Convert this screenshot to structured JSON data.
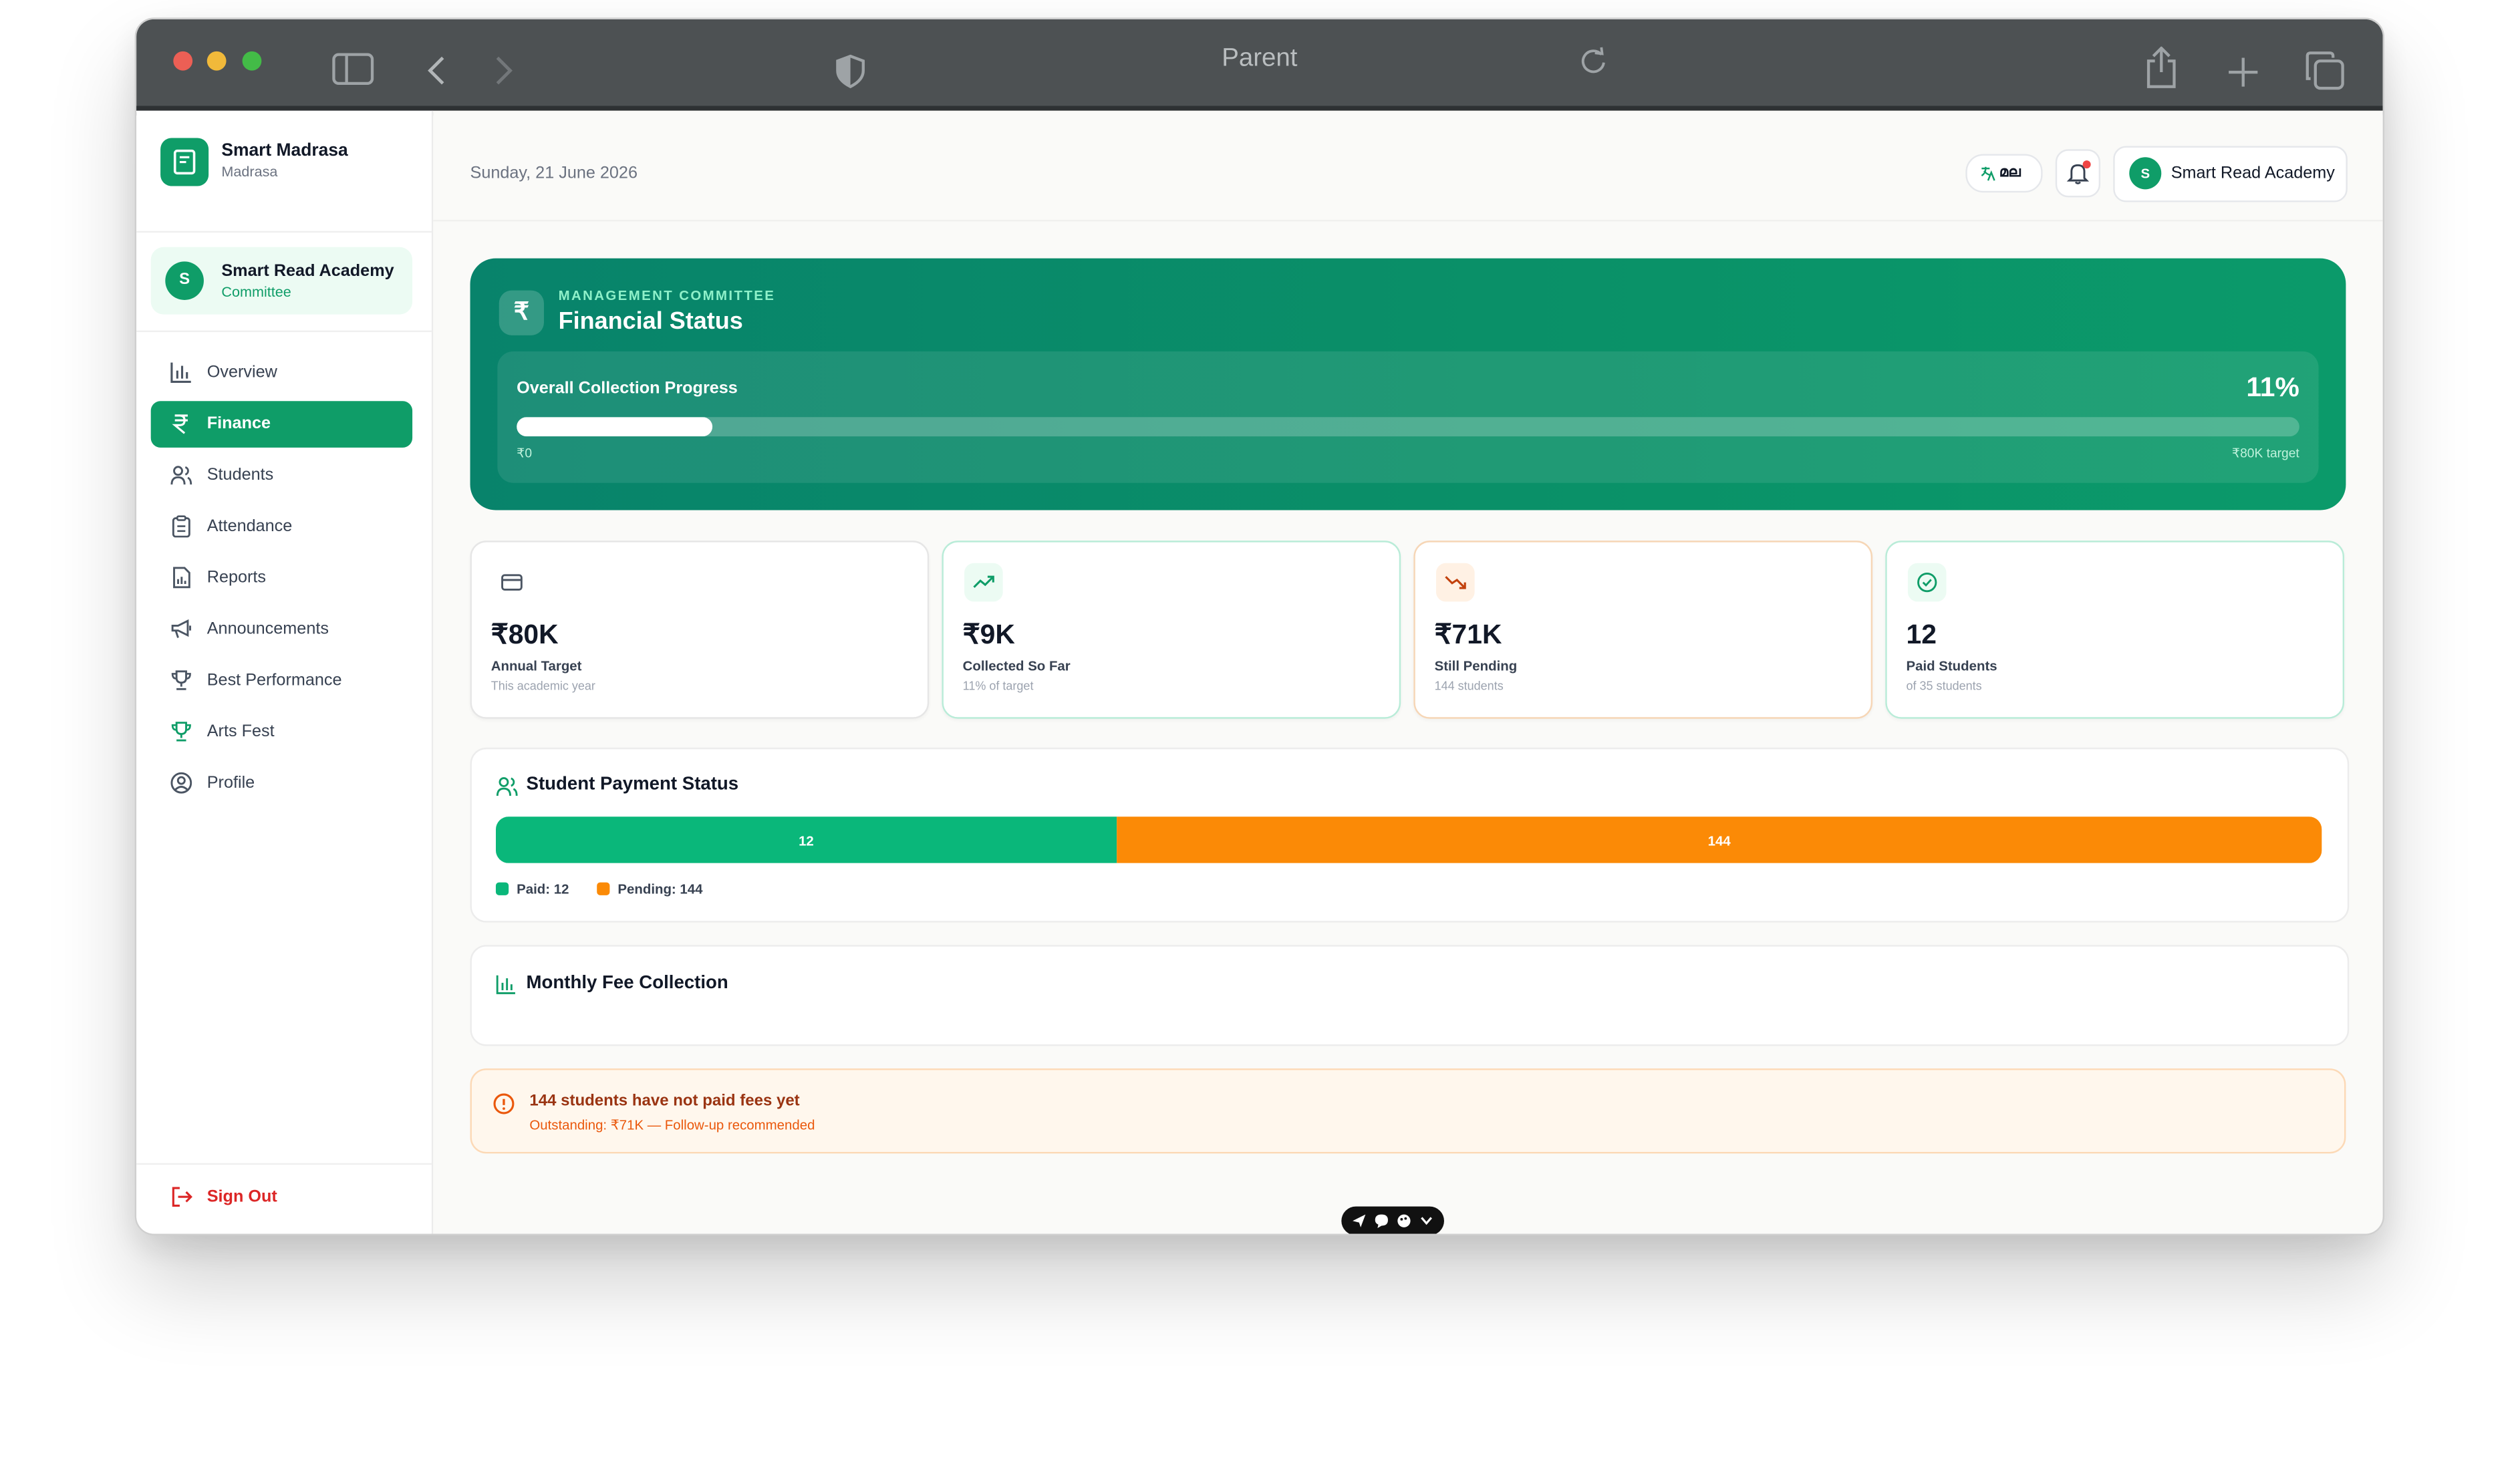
{
  "browser": {
    "title": "Parent"
  },
  "sidebar": {
    "brand_name": "Smart Madrasa",
    "brand_sub": "Madrasa",
    "org_initial": "S",
    "org_name": "Smart Read Academy",
    "org_role": "Committee",
    "items": [
      {
        "label": "Overview",
        "icon": "bar-chart-icon",
        "active": false
      },
      {
        "label": "Finance",
        "icon": "rupee-icon",
        "active": true
      },
      {
        "label": "Students",
        "icon": "users-icon",
        "active": false
      },
      {
        "label": "Attendance",
        "icon": "clipboard-icon",
        "active": false
      },
      {
        "label": "Reports",
        "icon": "report-icon",
        "active": false
      },
      {
        "label": "Announcements",
        "icon": "megaphone-icon",
        "active": false
      },
      {
        "label": "Best Performance",
        "icon": "trophy-icon",
        "active": false
      },
      {
        "label": "Arts Fest",
        "icon": "trophy-icon",
        "active": false
      },
      {
        "label": "Profile",
        "icon": "user-circle-icon",
        "active": false
      }
    ],
    "sign_out": "Sign Out"
  },
  "header": {
    "date": "Sunday, 21 June 2026",
    "language": "മല",
    "account_initial": "S",
    "account_name": "Smart Read Academy"
  },
  "hero": {
    "icon": "₹",
    "kicker": "MANAGEMENT COMMITTEE",
    "title": "Financial Status",
    "progress_label": "Overall Collection Progress",
    "progress_percent_text": "11%",
    "progress_fraction": 0.11,
    "min_label": "₹0",
    "max_label": "₹80K target"
  },
  "stats": [
    {
      "value": "₹80K",
      "label": "Annual Target",
      "sub": "This academic year",
      "icon": "card-icon",
      "color": "#6b7280"
    },
    {
      "value": "₹9K",
      "label": "Collected So Far",
      "sub": "11% of target",
      "icon": "trending-up-icon",
      "color": "#0f9d68"
    },
    {
      "value": "₹71K",
      "label": "Still Pending",
      "sub": "144 students",
      "icon": "trending-down-icon",
      "color": "#ea580c"
    },
    {
      "value": "12",
      "label": "Paid Students",
      "sub": "of 35 students",
      "icon": "check-circle-icon",
      "color": "#0f9d68"
    }
  ],
  "payment_status": {
    "title": "Student Payment Status",
    "paid_count": 12,
    "pending_count": 144,
    "paid_bar_label": "12",
    "pending_bar_label": "144",
    "paid_legend": "Paid: 12",
    "pending_legend": "Pending: 144",
    "paid_color": "#0ab77a",
    "pending_color": "#fb8a06"
  },
  "monthly": {
    "title": "Monthly Fee Collection"
  },
  "alert": {
    "title": "144 students have not paid fees yet",
    "subtitle": "Outstanding: ₹71K — Follow-up recommended"
  },
  "colors": {
    "accent": "#0f9d68",
    "danger": "#dc2626"
  }
}
